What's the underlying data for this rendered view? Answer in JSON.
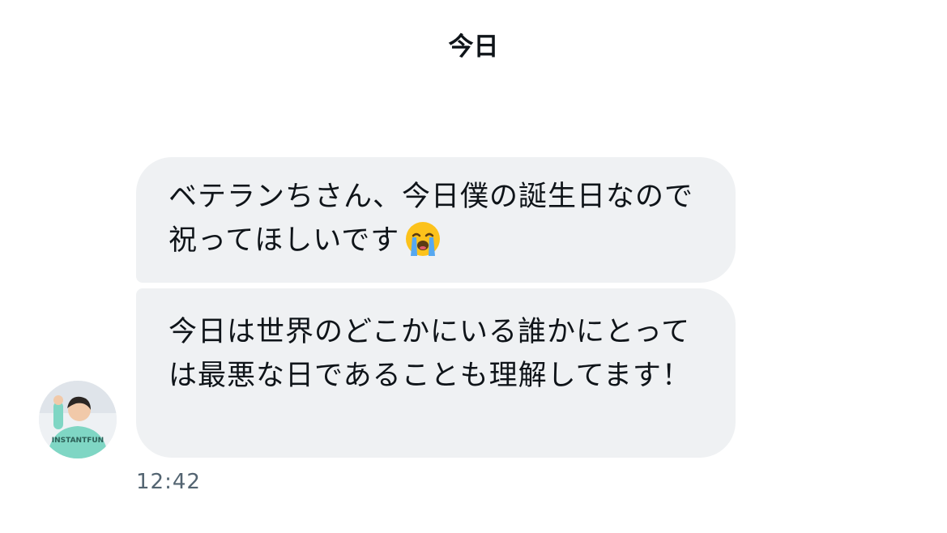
{
  "conversation": {
    "date_label": "今日",
    "messages": [
      {
        "text": "ベテランちさん、今日僕の誕生日なので祝ってほしいです",
        "emoji": "loudly-crying-face"
      },
      {
        "text": "今日は世界のどこかにいる誰かにとっては最悪な日であることも理解してます！"
      }
    ],
    "timestamp": "12:42",
    "avatar_shirt_text": "INSTANTFUN"
  },
  "colors": {
    "bubble_bg": "#eff1f3",
    "text": "#0f1419",
    "timestamp": "#536471",
    "avatar_shirt": "#7fd6c4"
  }
}
